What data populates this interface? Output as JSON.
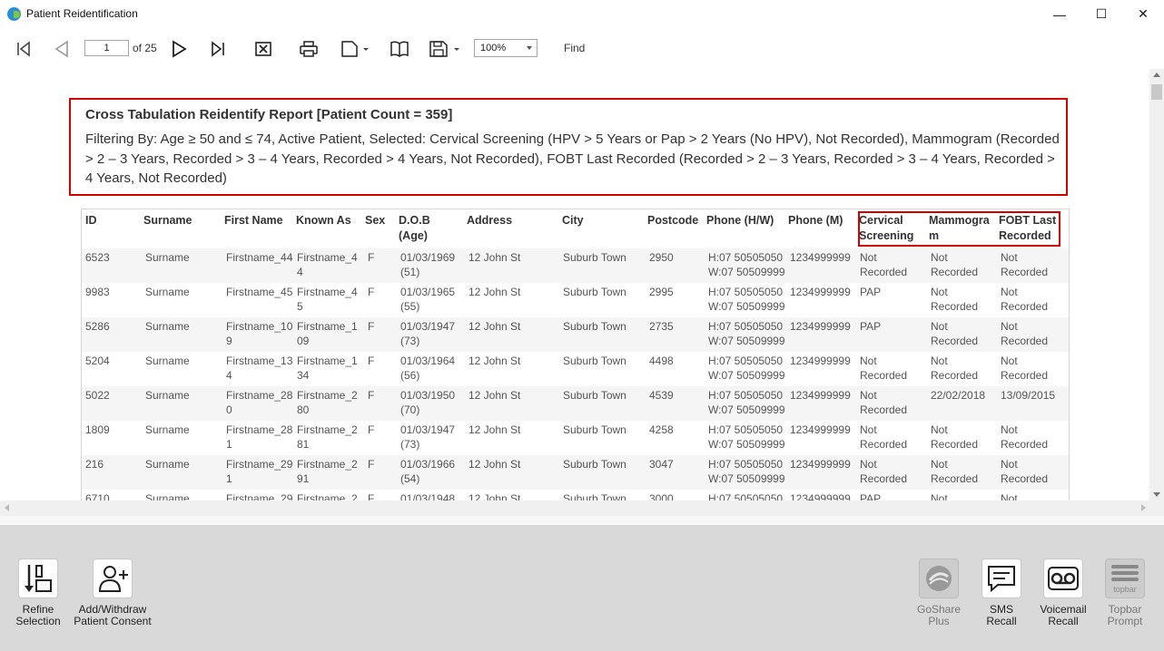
{
  "window": {
    "title": "Patient Reidentification",
    "minimize_glyph": "—",
    "maximize_glyph": "☐",
    "close_glyph": "✕"
  },
  "toolbar": {
    "page_value": "1",
    "of_pages": "of 25",
    "zoom_value": "100%",
    "find_label": "Find",
    "icons": [
      "first-page-icon",
      "previous-page-icon",
      "next-page-icon",
      "last-page-icon",
      "stop-icon",
      "print-icon",
      "page-setup-icon",
      "toggle-view-icon",
      "save-icon"
    ]
  },
  "report": {
    "title": "Cross Tabulation Reidentify Report  [Patient Count = 359]",
    "filter": "Filtering By: Age ≥ 50 and ≤ 74, Active Patient, Selected: Cervical Screening (HPV > 5 Years or Pap > 2 Years (No HPV), Not Recorded), Mammogram (Recorded > 2 – 3 Years, Recorded > 3 – 4 Years, Recorded > 4 Years, Not Recorded), FOBT Last Recorded (Recorded > 2 – 3 Years, Recorded > 3 – 4 Years, Recorded > 4 Years, Not Recorded)",
    "columns": [
      "ID",
      "Surname",
      "First Name",
      "Known As",
      "Sex",
      "D.O.B (Age)",
      "Address",
      "City",
      "Postcode",
      "Phone (H/W)",
      "Phone (M)",
      "Cervical Screening",
      "Mammogram",
      "FOBT Last Recorded"
    ],
    "rows": [
      [
        "6523",
        "Surname",
        "Firstname_44",
        "Firstname_44",
        "F",
        "01/03/1969 (51)",
        "12 John St",
        "Suburb Town",
        "2950",
        "H:07 50505050 W:07 50509999",
        "1234999999",
        "Not Recorded",
        "Not Recorded",
        "Not Recorded"
      ],
      [
        "9983",
        "Surname",
        "Firstname_45",
        "Firstname_45",
        "F",
        "01/03/1965 (55)",
        "12 John St",
        "Suburb Town",
        "2995",
        "H:07 50505050 W:07 50509999",
        "1234999999",
        "PAP",
        "Not Recorded",
        "Not Recorded"
      ],
      [
        "5286",
        "Surname",
        "Firstname_109",
        "Firstname_109",
        "F",
        "01/03/1947 (73)",
        "12 John St",
        "Suburb Town",
        "2735",
        "H:07 50505050 W:07 50509999",
        "1234999999",
        "PAP",
        "Not Recorded",
        "Not Recorded"
      ],
      [
        "5204",
        "Surname",
        "Firstname_134",
        "Firstname_134",
        "F",
        "01/03/1964 (56)",
        "12 John St",
        "Suburb Town",
        "4498",
        "H:07 50505050 W:07 50509999",
        "1234999999",
        "Not Recorded",
        "Not Recorded",
        "Not Recorded"
      ],
      [
        "5022",
        "Surname",
        "Firstname_280",
        "Firstname_280",
        "F",
        "01/03/1950 (70)",
        "12 John St",
        "Suburb Town",
        "4539",
        "H:07 50505050 W:07 50509999",
        "1234999999",
        "Not Recorded",
        "22/02/2018",
        "13/09/2015"
      ],
      [
        "1809",
        "Surname",
        "Firstname_281",
        "Firstname_281",
        "F",
        "01/03/1947 (73)",
        "12 John St",
        "Suburb Town",
        "4258",
        "H:07 50505050 W:07 50509999",
        "1234999999",
        "Not Recorded",
        "Not Recorded",
        "Not Recorded"
      ],
      [
        "216",
        "Surname",
        "Firstname_291",
        "Firstname_291",
        "F",
        "01/03/1966 (54)",
        "12 John St",
        "Suburb Town",
        "3047",
        "H:07 50505050 W:07 50509999",
        "1234999999",
        "Not Recorded",
        "Not Recorded",
        "Not Recorded"
      ],
      [
        "6710",
        "Surname",
        "Firstname_29",
        "Firstname_29",
        "F",
        "01/03/1948",
        "12 John St",
        "Suburb Town",
        "3000",
        "H:07 50505050",
        "1234999999",
        "PAP",
        "Not",
        "Not"
      ]
    ]
  },
  "actions": {
    "refine": "Refine Selection",
    "consent": "Add/Withdraw Patient Consent",
    "goshare": "GoShare Plus",
    "sms": "SMS Recall",
    "voicemail": "Voicemail Recall",
    "topbar": "Topbar Prompt",
    "topbar_logo": "topbar"
  },
  "colors": {
    "highlight_border": "#d40000",
    "panel_bg": "#d9d9d9"
  }
}
